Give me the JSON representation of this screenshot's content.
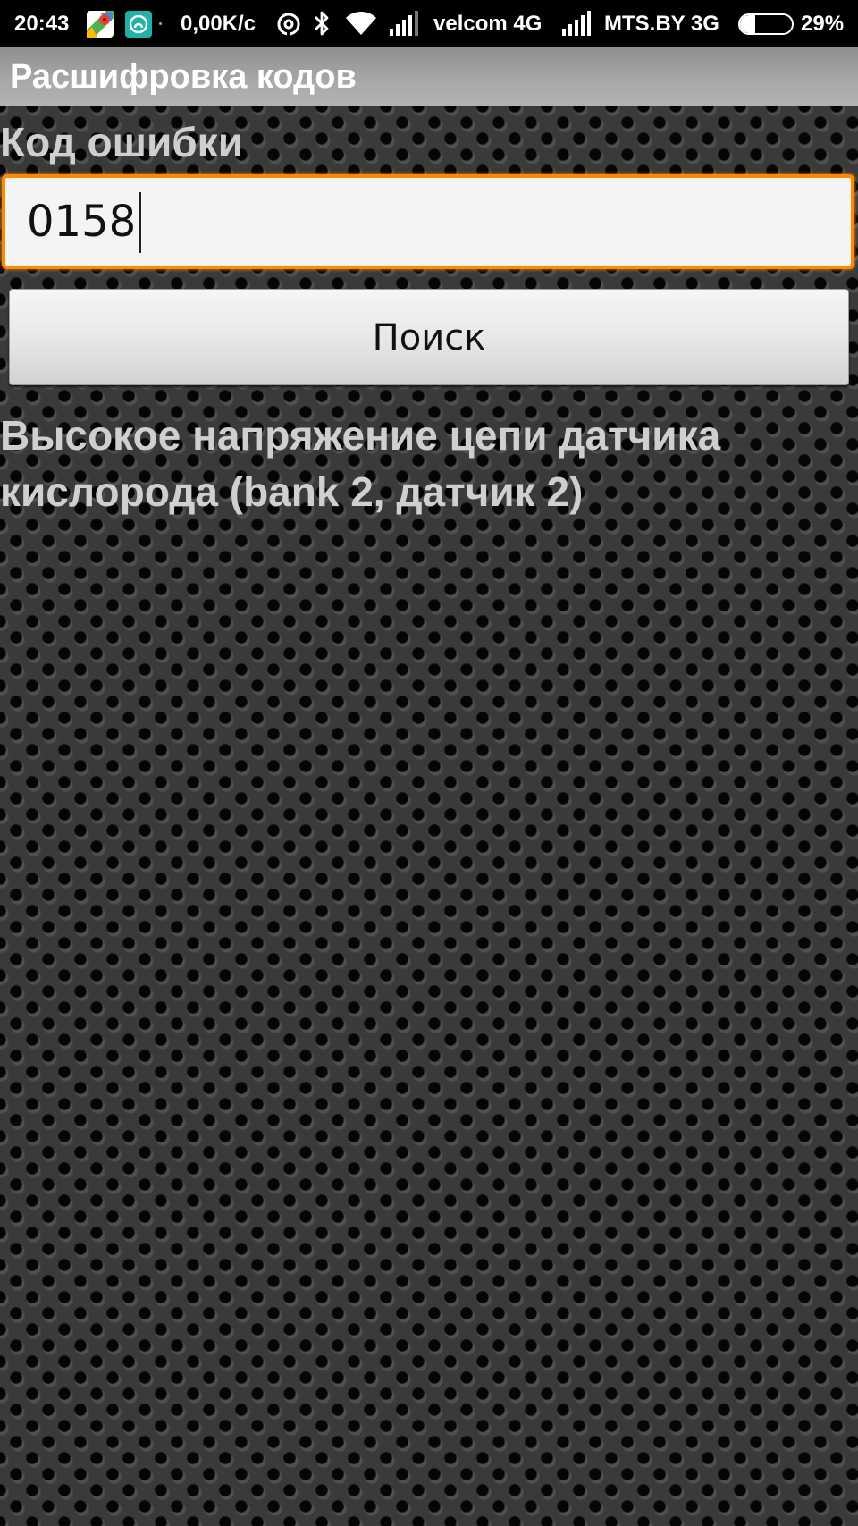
{
  "status_bar": {
    "time": "20:43",
    "speed": "0,00K/c",
    "operator1": "velcom 4G",
    "operator2": "MTS.BY 3G",
    "battery_percent": "29%",
    "battery_level": 0.29,
    "icons": [
      "maps-icon",
      "app-icon",
      "hotspot-icon",
      "bluetooth-icon",
      "wifi-icon",
      "signal-icon",
      "signal-icon",
      "battery-icon"
    ]
  },
  "app": {
    "title": "Расшифровка кодов"
  },
  "form": {
    "code_label": "Код ошибки",
    "code_value": "0158",
    "search_label": "Поиск"
  },
  "result": {
    "text": "Высокое напряжение цепи датчика кислорода (bank 2, датчик 2)"
  },
  "colors": {
    "input_focus_border": "#ff8a00",
    "background": "#323232",
    "label_text": "#cfcfcf"
  }
}
